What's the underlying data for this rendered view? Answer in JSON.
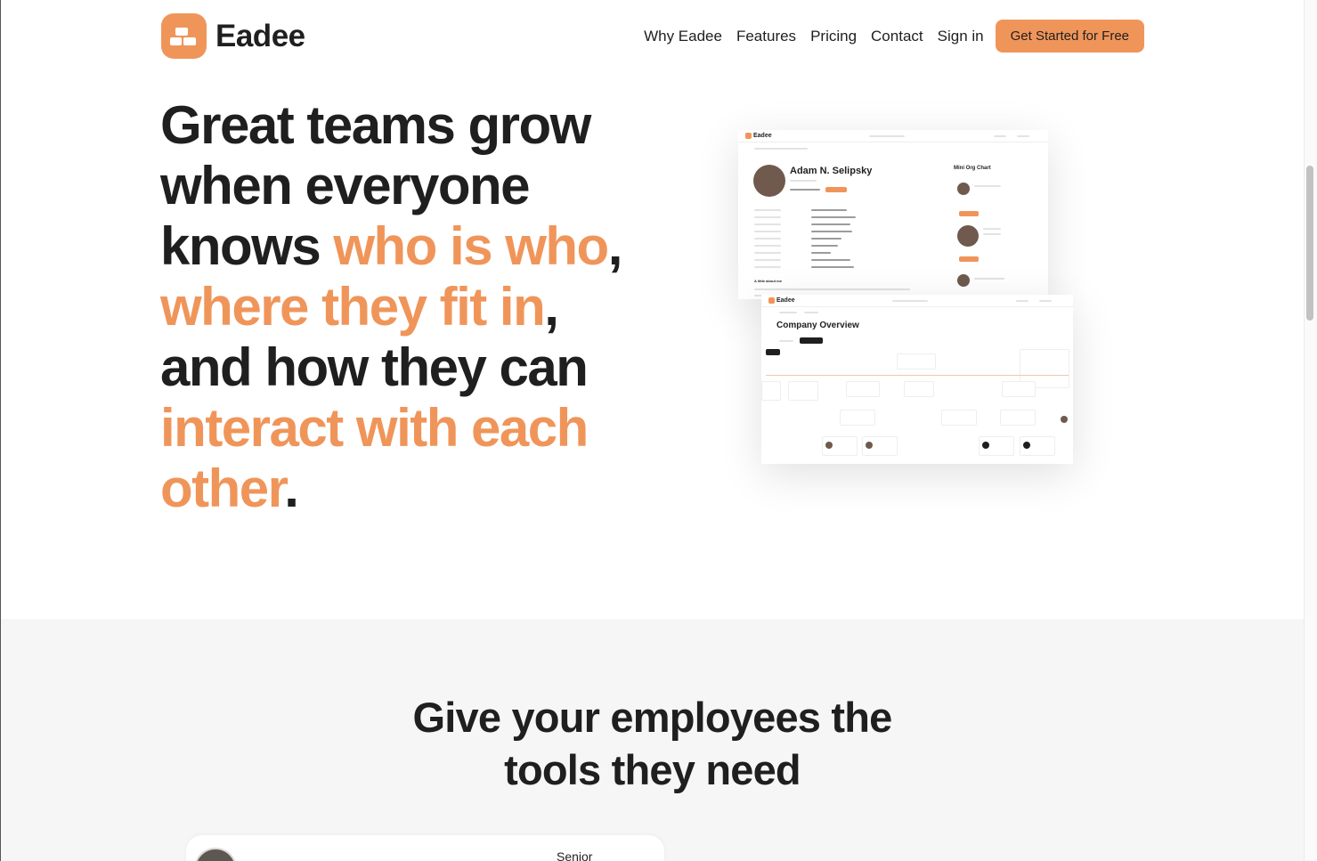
{
  "header": {
    "logo_text": "Eadee",
    "nav": [
      "Why Eadee",
      "Features",
      "Pricing",
      "Contact",
      "Sign in"
    ],
    "cta_label": "Get Started for Free"
  },
  "hero": {
    "line1": "Great teams grow",
    "line2": "when everyone",
    "line3_plain": "knows ",
    "line3_accent": "who is who",
    "line3_punct": ",",
    "line4_accent": "where they fit in",
    "line4_punct": ",",
    "line5": "and how they can",
    "line6_accent": "interact with each",
    "line7_accent": "other",
    "line7_punct": "."
  },
  "profile_shot": {
    "logo": "Eadee",
    "name": "Adam N. Selipsky",
    "mini_org_title": "Mini Org Chart",
    "about_title": "A little about me"
  },
  "overview_shot": {
    "logo": "Eadee",
    "title": "Company Overview"
  },
  "features": {
    "title_line1": "Give your employees the",
    "title_line2": "tools they need",
    "card_label": "Senior"
  },
  "colors": {
    "accent": "#f0955a",
    "text": "#1f1f1f",
    "section_bg": "#f6f6f6"
  }
}
